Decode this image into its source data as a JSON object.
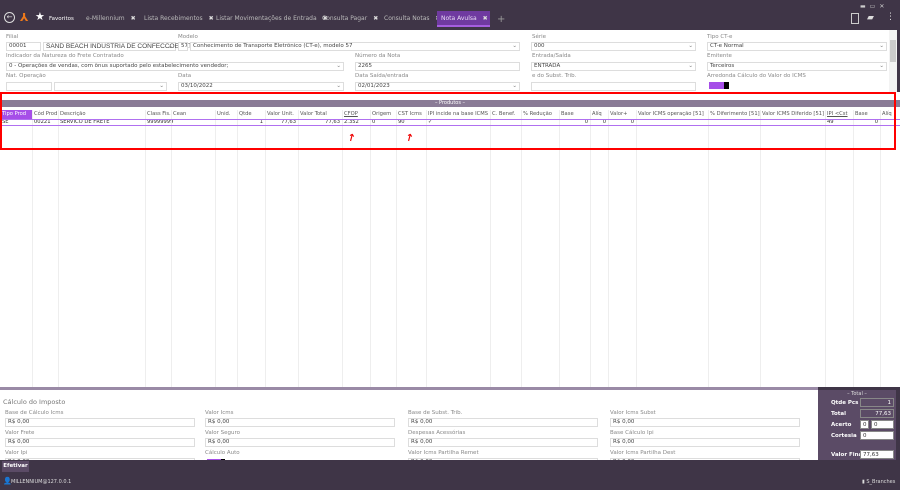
{
  "topbar": {
    "favorites": "Favoritos",
    "tabs": [
      {
        "label": "e-Millennium"
      },
      {
        "label": "Lista Recebimentos"
      },
      {
        "label": "Listar Movimentações de Entrada"
      },
      {
        "label": "Consulta Pagar"
      },
      {
        "label": "Consulta Notas"
      },
      {
        "label": "Nota Avulsa"
      }
    ],
    "active_tab": "Nota Avulsa",
    "accent": "#6f3aa0"
  },
  "form": {
    "filial_label": "Filial",
    "filial_code": "00001",
    "filial_name": "SAND BEACH INDUSTRIA DE CONFECCOES LTDA",
    "modelo_label": "Modelo",
    "modelo_code": "57",
    "modelo_name": "Conhecimento de Transporte Eletrônico (CT-e), modelo 57",
    "serie_label": "Série",
    "serie": "000",
    "tipo_cte_label": "Tipo CT-e",
    "tipo_cte": "CT-e Normal",
    "indicador_label": "Indicador da Natureza do Frete Contratado",
    "indicador": "0 - Operações de vendas, com ônus suportado pelo estabelecimento vendedor;",
    "numero_label": "Número da Nota",
    "numero": "2265",
    "entrada_saida_label": "Entrada/Saída",
    "entrada_saida": "ENTRADA",
    "emitente_label": "Emitente",
    "emitente": "Terceiros",
    "nat_label": "Nat. Operação",
    "data_label": "Data",
    "data": "03/10/2022",
    "data_saida_label": "Data Saída/entrada",
    "data_saida": "02/01/2023",
    "subst_label": "e do Subst. Trib.",
    "arredonda_label": "Arredonda Cálculo do Valor do ICMS"
  },
  "products": {
    "section_label": "Produtos",
    "headers": [
      "Tipo Prod",
      "Cód Prod",
      "Descrição",
      "Class Fis.",
      "Cean",
      "Unid.",
      "Qtde",
      "Valor Unit.",
      "Valor Total",
      "CFOP",
      "Origem",
      "CST Icms",
      "IPI incide na base ICMS",
      "C. Benef.",
      "% Redução",
      "Base",
      "Alíq",
      "Valor+",
      "Valor ICMS operação [51]",
      "% Diferimento [51]",
      "Valor ICMS Diferido [51]",
      "IPI <Cst",
      "Base",
      "Alíq"
    ],
    "rows": [
      [
        "SE",
        "00221",
        "SERVICO DE FRETE",
        "99999999",
        "",
        "",
        "1",
        "77,63",
        "77,63",
        "2.352",
        "0",
        "90",
        "✓",
        "",
        "",
        "0",
        "0",
        "0",
        "",
        "",
        "",
        "49",
        "0",
        ""
      ]
    ]
  },
  "tax": {
    "title": "Cálculo do Imposto",
    "fields": [
      {
        "label": "Base de Cálculo Icms",
        "value": "R$ 0,00"
      },
      {
        "label": "Valor Icms",
        "value": "R$ 0,00"
      },
      {
        "label": "Base de Subst. Trib.",
        "value": "R$ 0,00"
      },
      {
        "label": "Valor Icms Subst",
        "value": "R$ 0,00"
      },
      {
        "label": "Valor Frete",
        "value": "R$ 0,00"
      },
      {
        "label": "Valor Seguro",
        "value": "R$ 0,00"
      },
      {
        "label": "Despesas Acessórias",
        "value": "R$ 0,00"
      },
      {
        "label": "Base Cálculo Ipi",
        "value": "R$ 0,00"
      },
      {
        "label": "Valor Ipi",
        "value": "R$ 0,00"
      },
      {
        "label": "Cálculo Auto",
        "value": ""
      },
      {
        "label": "Valor Icms Partilha Remet",
        "value": "R$ 0,00"
      },
      {
        "label": "Valor Icms Partilha Dest",
        "value": "R$ 0,00"
      }
    ]
  },
  "total": {
    "title": "Total",
    "qtde_label": "Qtde Pcs",
    "qtde": "1",
    "total_label": "Total",
    "total": "77,63",
    "acerto_label": "Acerto",
    "acerto1": "0",
    "acerto2": "0",
    "cortesia_label": "Cortesia",
    "cortesia": "0",
    "valor_final_label": "Valor Final",
    "valor_final": "77,63"
  },
  "footer": {
    "efetivar": "Efetivar",
    "user": "MILLENNIUM@127.0.0.1",
    "branch": "S_Branches"
  }
}
